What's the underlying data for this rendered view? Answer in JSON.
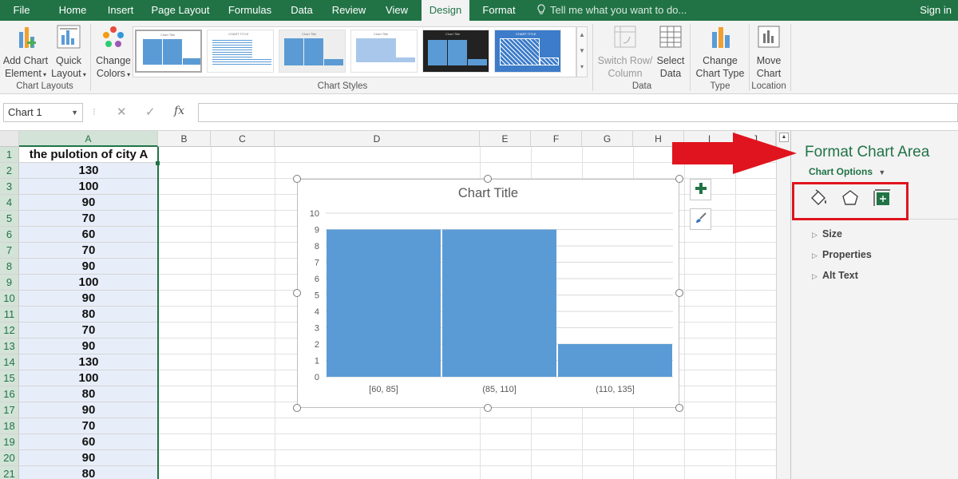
{
  "ribbon_tabs": [
    "File",
    "Home",
    "Insert",
    "Page Layout",
    "Formulas",
    "Data",
    "Review",
    "View",
    "Design",
    "Format"
  ],
  "tell_me": "Tell me what you want to do...",
  "sign_in": "Sign in",
  "ribbon": {
    "add_chart_element": [
      "Add Chart",
      "Element"
    ],
    "quick_layout": [
      "Quick",
      "Layout"
    ],
    "chart_layouts_label": "Chart Layouts",
    "change_colors": [
      "Change",
      "Colors"
    ],
    "chart_styles_label": "Chart Styles",
    "switch_row_column": [
      "Switch Row/",
      "Column"
    ],
    "select_data": [
      "Select",
      "Data"
    ],
    "data_label": "Data",
    "change_chart_type": [
      "Change",
      "Chart Type"
    ],
    "type_label": "Type",
    "move_chart": [
      "Move",
      "Chart"
    ],
    "location_label": "Location",
    "style_thumb_titles": [
      "Chart Title",
      "CHART TITLE",
      "Chart Title",
      "Chart Title",
      "Chart Title",
      "CHART TITLE"
    ]
  },
  "formula_bar": {
    "name_box": "Chart 1",
    "cancel": "✕",
    "enter": "✓",
    "fx": "fx",
    "value": ""
  },
  "columns": [
    "A",
    "B",
    "C",
    "D",
    "E",
    "F",
    "G",
    "H",
    "I",
    "J"
  ],
  "rows": [
    "1",
    "2",
    "3",
    "4",
    "5",
    "6",
    "7",
    "8",
    "9",
    "10",
    "11",
    "12",
    "13",
    "14",
    "15",
    "16",
    "17",
    "18",
    "19",
    "20",
    "21"
  ],
  "column_a_values": [
    "the pulotion of city A",
    "130",
    "100",
    "90",
    "70",
    "60",
    "70",
    "90",
    "100",
    "90",
    "80",
    "70",
    "90",
    "130",
    "100",
    "80",
    "90",
    "70",
    "60",
    "90",
    "80"
  ],
  "chart_data": {
    "type": "bar",
    "title": "Chart Title",
    "categories": [
      "[60, 85]",
      "(85, 110]",
      "(110, 135]"
    ],
    "values": [
      9,
      9,
      2
    ],
    "ylim": [
      0,
      10
    ],
    "yticks": [
      "0",
      "1",
      "2",
      "3",
      "4",
      "5",
      "6",
      "7",
      "8",
      "9",
      "10"
    ],
    "grid": true,
    "bar_color": "#5b9bd5"
  },
  "chart_side_buttons": {
    "elements_icon": "plus-icon",
    "styles_icon": "brush-icon"
  },
  "format_pane": {
    "title": "Format Chart Area",
    "options_label": "Chart Options",
    "tab_icons": [
      "fill-line-icon",
      "effects-icon",
      "size-properties-icon"
    ],
    "sections": [
      "Size",
      "Properties",
      "Alt Text"
    ]
  },
  "colors": {
    "excel_green": "#217346",
    "highlight_red": "#e0141e",
    "bar": "#5b9bd5"
  }
}
